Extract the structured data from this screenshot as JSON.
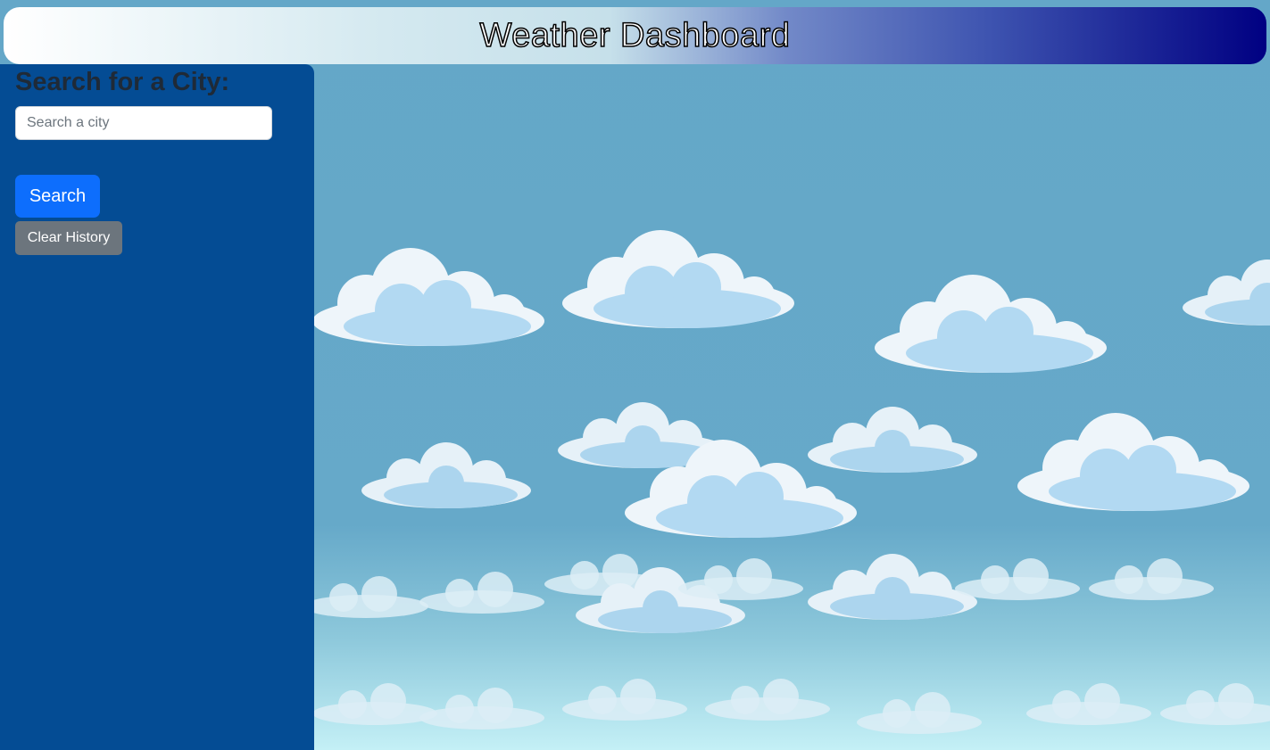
{
  "header": {
    "title": "Weather Dashboard"
  },
  "sidebar": {
    "heading": "Search for a City:",
    "search_input": {
      "value": "",
      "placeholder": "Search a city"
    },
    "search_button_label": "Search",
    "clear_history_label": "Clear History"
  },
  "colors": {
    "sidebar_bg": "#044c94",
    "search_button": "#0d6efd",
    "clear_button": "#6c757d",
    "header_gradient_end": "#000082",
    "sky": "#64a7c8"
  },
  "background": {
    "description_icon": "clouds-background"
  }
}
